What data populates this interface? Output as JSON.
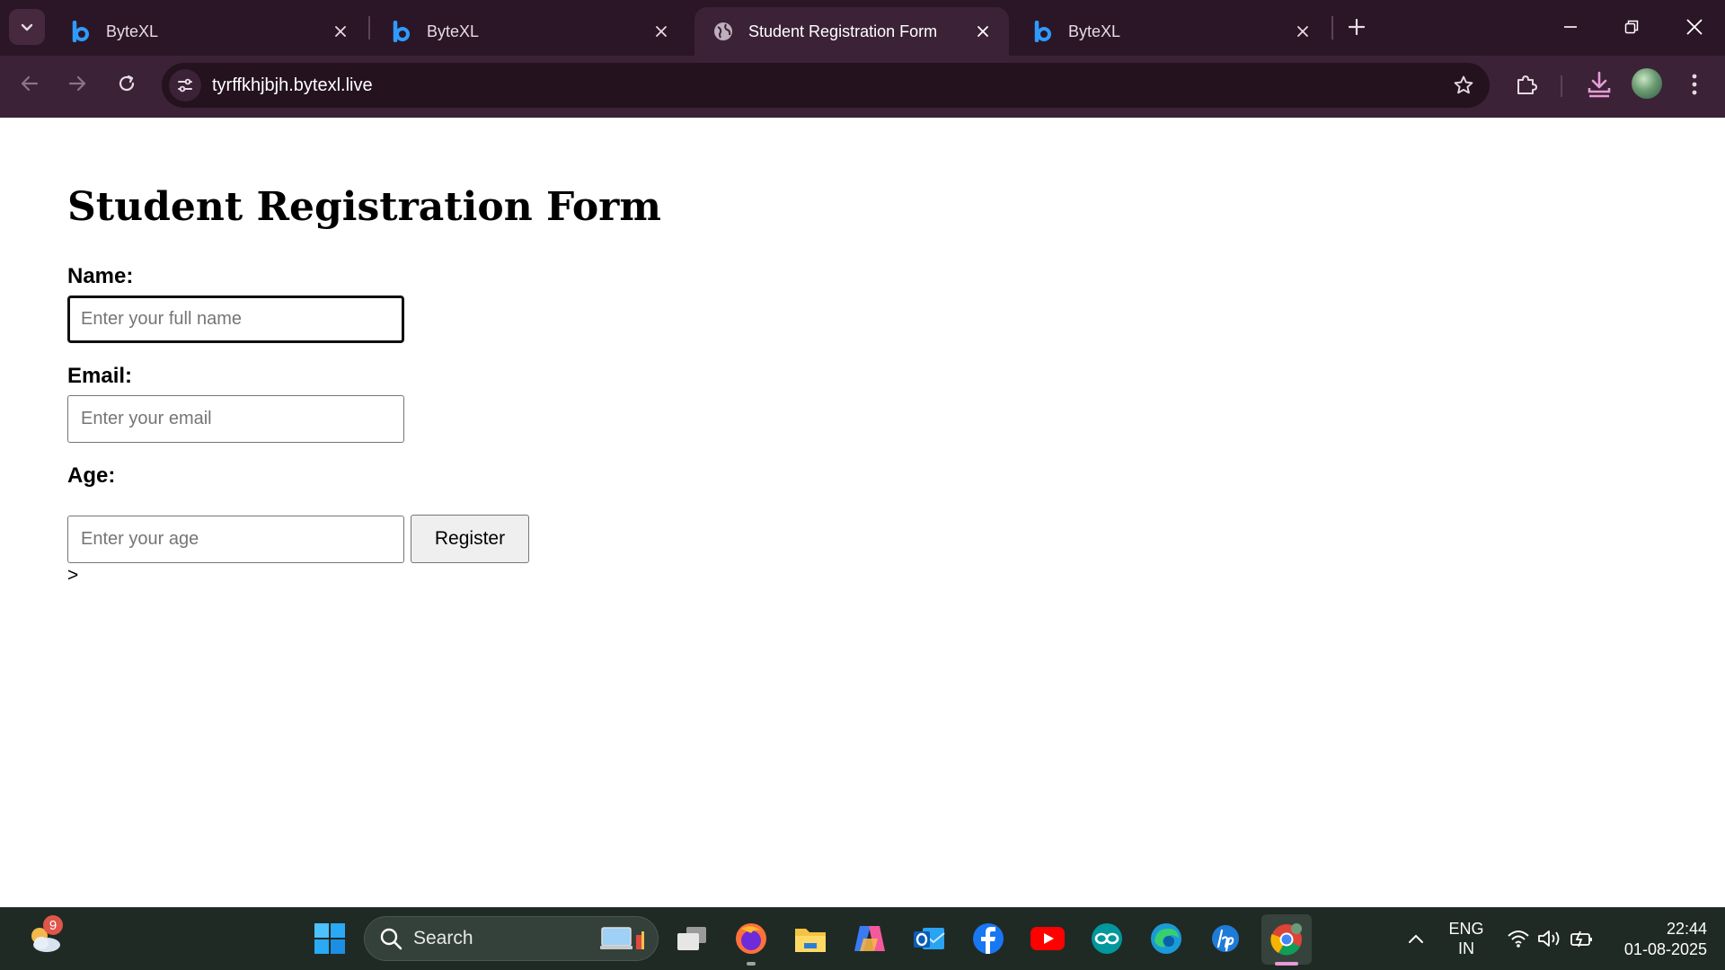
{
  "browser": {
    "tabs": [
      {
        "title": "ByteXL",
        "favicon": "bytexl-b-icon",
        "active": false
      },
      {
        "title": "ByteXL",
        "favicon": "bytexl-b-icon",
        "active": false
      },
      {
        "title": "Student Registration Form",
        "favicon": "globe-icon",
        "active": true
      },
      {
        "title": "ByteXL",
        "favicon": "bytexl-b-icon",
        "active": false
      }
    ],
    "url": "tyrffkhjbjh.bytexl.live"
  },
  "page": {
    "heading": "Student Registration Form",
    "form": {
      "name_label": "Name:",
      "name_placeholder": "Enter your full name",
      "name_value": "",
      "email_label": "Email:",
      "email_placeholder": "Enter your email",
      "email_value": "",
      "age_label": "Age:",
      "age_placeholder": "Enter your age",
      "age_value": "",
      "register_label": "Register"
    },
    "stray_text": ">"
  },
  "taskbar": {
    "weather_badge": "9",
    "search_label": "Search",
    "language_line1": "ENG",
    "language_line2": "IN",
    "time": "22:44",
    "date": "01-08-2025"
  },
  "colors": {
    "chrome_bg": "#3b2236",
    "tabstrip_bg": "#2b1627",
    "accent_pink": "#e89bd6",
    "taskbar_bg": "#1f2a25"
  }
}
